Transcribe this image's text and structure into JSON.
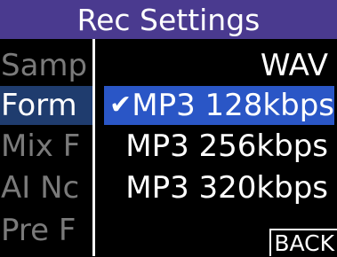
{
  "title": "Rec Settings",
  "menu": {
    "items": [
      {
        "label": "Samp",
        "selected": false
      },
      {
        "label": "Form",
        "selected": true
      },
      {
        "label": "Mix F",
        "selected": false
      },
      {
        "label": "AI Nc",
        "selected": false
      },
      {
        "label": "Pre F",
        "selected": false
      }
    ]
  },
  "options": {
    "items": [
      {
        "label": "WAV",
        "selected": false
      },
      {
        "label": "MP3 128kbps",
        "selected": true
      },
      {
        "label": "MP3 256kbps",
        "selected": false
      },
      {
        "label": "MP3 320kbps",
        "selected": false
      }
    ],
    "check_icon": "✔"
  },
  "back_label": "BACK",
  "colors": {
    "title_bg": "#4a3a8f",
    "menu_selected_bg": "#1f3c6e",
    "option_selected_bg": "#2a56c6",
    "inactive_text": "#7a7a7a"
  }
}
